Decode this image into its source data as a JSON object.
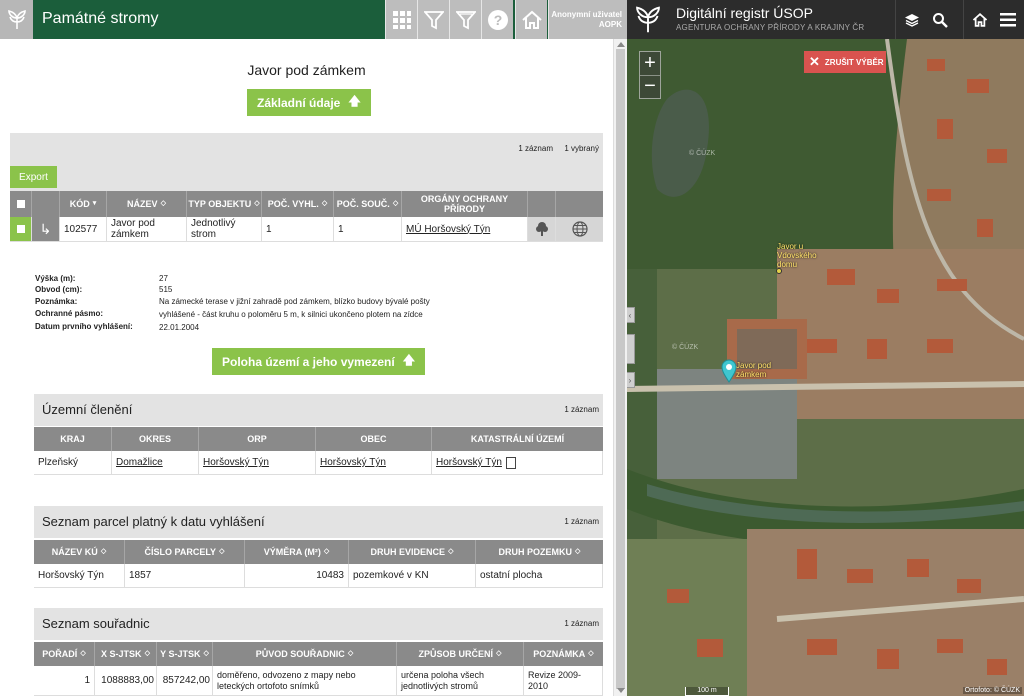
{
  "header": {
    "app_title": "Památné stromy",
    "user_line1": "Anonymní uživatel",
    "user_line2": "AOPK",
    "icons": [
      "grid-icon",
      "filter-icon",
      "filter-clear-icon",
      "help-icon",
      "home-icon"
    ]
  },
  "right_header": {
    "title": "Digitální registr ÚSOP",
    "subtitle": "AGENTURA OCHRANY PŘÍRODY A KRAJINY ČR"
  },
  "detail": {
    "title": "Javor pod zámkem",
    "basic_button": "Základní údaje",
    "count_records": "1 záznam",
    "count_selected": "1 vybraný",
    "export_button": "Export",
    "table": {
      "headers": [
        "KÓD",
        "NÁZEV",
        "TYP OBJEKTU",
        "POČ. VYHL.",
        "POČ. SOUČ.",
        "ORGÁNY OCHRANY PŘÍRODY"
      ],
      "row": [
        "102577",
        "Javor pod zámkem",
        "Jednotlivý strom",
        "1",
        "1",
        "MÚ Horšovský Týn"
      ]
    },
    "attributes": [
      {
        "label": "Výška (m):",
        "value": "27"
      },
      {
        "label": "Obvod (cm):",
        "value": "515"
      },
      {
        "label": "Poznámka:",
        "value": "Na zámecké terase v jižní zahradě pod zámkem, blízko budovy bývalé pošty"
      },
      {
        "label": "Ochranné pásmo:",
        "value": "vyhlášené - část kruhu o poloměru 5 m, k silnici ukončeno plotem na zídce"
      },
      {
        "label": "Datum prvního vyhlášení:",
        "value": "22.01.2004"
      }
    ],
    "location_button": "Poloha území a jeho vymezení"
  },
  "territorial": {
    "title": "Územní členění",
    "count": "1 záznam",
    "headers": [
      "KRAJ",
      "OKRES",
      "ORP",
      "OBEC",
      "KATASTRÁLNÍ ÚZEMÍ"
    ],
    "row": [
      "Plzeňský",
      "Domažlice",
      "Horšovský Týn",
      "Horšovský Týn",
      "Horšovský Týn"
    ]
  },
  "parcels": {
    "title": "Seznam parcel platný k datu vyhlášení",
    "count": "1 záznam",
    "headers": [
      "NÁZEV KÚ",
      "ČÍSLO PARCELY",
      "VÝMĚRA (M²)",
      "DRUH EVIDENCE",
      "DRUH POZEMKU"
    ],
    "row": [
      "Horšovský Týn",
      "1857",
      "10483",
      "pozemkové v KN",
      "ostatní plocha"
    ]
  },
  "coords": {
    "title": "Seznam souřadnic",
    "count": "1 záznam",
    "headers": [
      "POŘADÍ",
      "X S-JTSK",
      "Y S-JTSK",
      "PŮVOD SOUŘADNIC",
      "ZPŮSOB URČENÍ",
      "POZNÁMKA"
    ],
    "row": [
      "1",
      "1088883,00",
      "857242,00",
      "doměřeno, odvozeno z mapy nebo leteckých ortofoto snímků",
      "určena poloha všech jednotlivých stromů",
      "Revize 2009-2010"
    ]
  },
  "map": {
    "cancel_button": "ZRUŠIT VÝBĚR",
    "zoom_in": "+",
    "zoom_out": "−",
    "label_tree2": "Javor u Vdovského domu",
    "label_tree1": "Javor pod zámkem",
    "watermark": "© ČÚZK",
    "scale": "100 m",
    "credit": "Ortofoto: © ČÚZK"
  },
  "colors": {
    "header_green": "#1b5e3b",
    "accent_green": "#8bc34a",
    "map_button_red": "#d9534f",
    "marker": "#3fc6cf"
  }
}
